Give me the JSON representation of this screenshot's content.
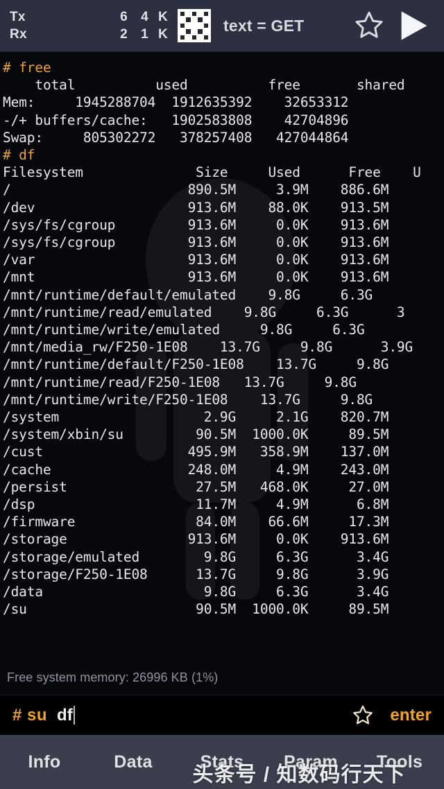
{
  "header": {
    "tx_label": "Tx",
    "rx_label": "Rx",
    "tx_count": "6",
    "rx_count": "2",
    "tx_bytes": "4",
    "rx_bytes": "1",
    "tx_unit": "K",
    "rx_unit": "K",
    "mode_icon": "qr-code-icon",
    "title": "text = GET",
    "favorite_icon": "star-outline-icon",
    "run_icon": "play-triangle-icon"
  },
  "terminal": {
    "lines": [
      {
        "text": "# free",
        "type": "cmd"
      },
      {
        "text": "    total          used          free       shared       bu",
        "type": "out"
      },
      {
        "text": "Mem:     1945288704  1912635392    32653312            ",
        "type": "out"
      },
      {
        "text": "-/+ buffers/cache:   1902583808    42704896",
        "type": "out"
      },
      {
        "text": "Swap:     805302272   378257408   427044864",
        "type": "out"
      },
      {
        "text": "# df",
        "type": "cmd"
      },
      {
        "text": "Filesystem              Size     Used      Free    U",
        "type": "out"
      },
      {
        "text": "/                      890.5M     3.9M    886.6M   ",
        "type": "out"
      },
      {
        "text": "/dev                   913.6M    88.0K    913.5M   ",
        "type": "out"
      },
      {
        "text": "/sys/fs/cgroup         913.6M     0.0K    913.6M   ",
        "type": "out"
      },
      {
        "text": "/sys/fs/cgroup         913.6M     0.0K    913.6M   ",
        "type": "out"
      },
      {
        "text": "/var                   913.6M     0.0K    913.6M   ",
        "type": "out"
      },
      {
        "text": "/mnt                   913.6M     0.0K    913.6M   ",
        "type": "out"
      },
      {
        "text": "/mnt/runtime/default/emulated    9.8G     6.3G",
        "type": "out"
      },
      {
        "text": "/mnt/runtime/read/emulated    9.8G     6.3G      3",
        "type": "out"
      },
      {
        "text": "/mnt/runtime/write/emulated     9.8G     6.3G    ",
        "type": "out"
      },
      {
        "text": "/mnt/media_rw/F250-1E08    13.7G     9.8G      3.9G",
        "type": "out"
      },
      {
        "text": "/mnt/runtime/default/F250-1E08    13.7G     9.8G",
        "type": "out"
      },
      {
        "text": "/mnt/runtime/read/F250-1E08   13.7G     9.8G     ",
        "type": "out"
      },
      {
        "text": "/mnt/runtime/write/F250-1E08    13.7G     9.8G",
        "type": "out"
      },
      {
        "text": "/system                  2.9G     2.1G    820.7M   ",
        "type": "out"
      },
      {
        "text": "/system/xbin/su         90.5M  1000.0K     89.5M   ",
        "type": "out"
      },
      {
        "text": "/cust                  495.9M   358.9M    137.0M   ",
        "type": "out"
      },
      {
        "text": "/cache                 248.0M     4.9M    243.0M   ",
        "type": "out"
      },
      {
        "text": "/persist                27.5M   468.0K     27.0M   ",
        "type": "out"
      },
      {
        "text": "/dsp                    11.7M     4.9M      6.8M   ",
        "type": "out"
      },
      {
        "text": "/firmware               84.0M    66.6M     17.3M",
        "type": "out"
      },
      {
        "text": "/storage               913.6M     0.0K    913.6M   ",
        "type": "out"
      },
      {
        "text": "/storage/emulated        9.8G     6.3G      3.4G   ",
        "type": "out"
      },
      {
        "text": "/storage/F250-1E08      13.7G     9.8G      3.9G   ",
        "type": "out"
      },
      {
        "text": "/data                    9.8G     6.3G      3.4G   ",
        "type": "out"
      },
      {
        "text": "/su                     90.5M  1000.0K     89.5M   ",
        "type": "out"
      }
    ]
  },
  "status": {
    "memory_text": "Free system memory: 26996 KB  (1%)"
  },
  "command_bar": {
    "prompt": "# su",
    "value": "df",
    "favorite_icon": "star-outline-icon",
    "enter_label": "enter"
  },
  "tabs": [
    {
      "label": "Info"
    },
    {
      "label": "Data"
    },
    {
      "label": "Stats"
    },
    {
      "label": "Param"
    },
    {
      "label": "Tools"
    }
  ],
  "watermark": {
    "text": "头条号 / 知数码行天下"
  },
  "colors": {
    "header_bg": "#2d3040",
    "terminal_bg": "#06080c",
    "accent_orange": "#f0a32a",
    "tabbar_bg": "#3b3f4d",
    "text_primary": "#e6e8ec",
    "text_muted": "#8f949e"
  }
}
